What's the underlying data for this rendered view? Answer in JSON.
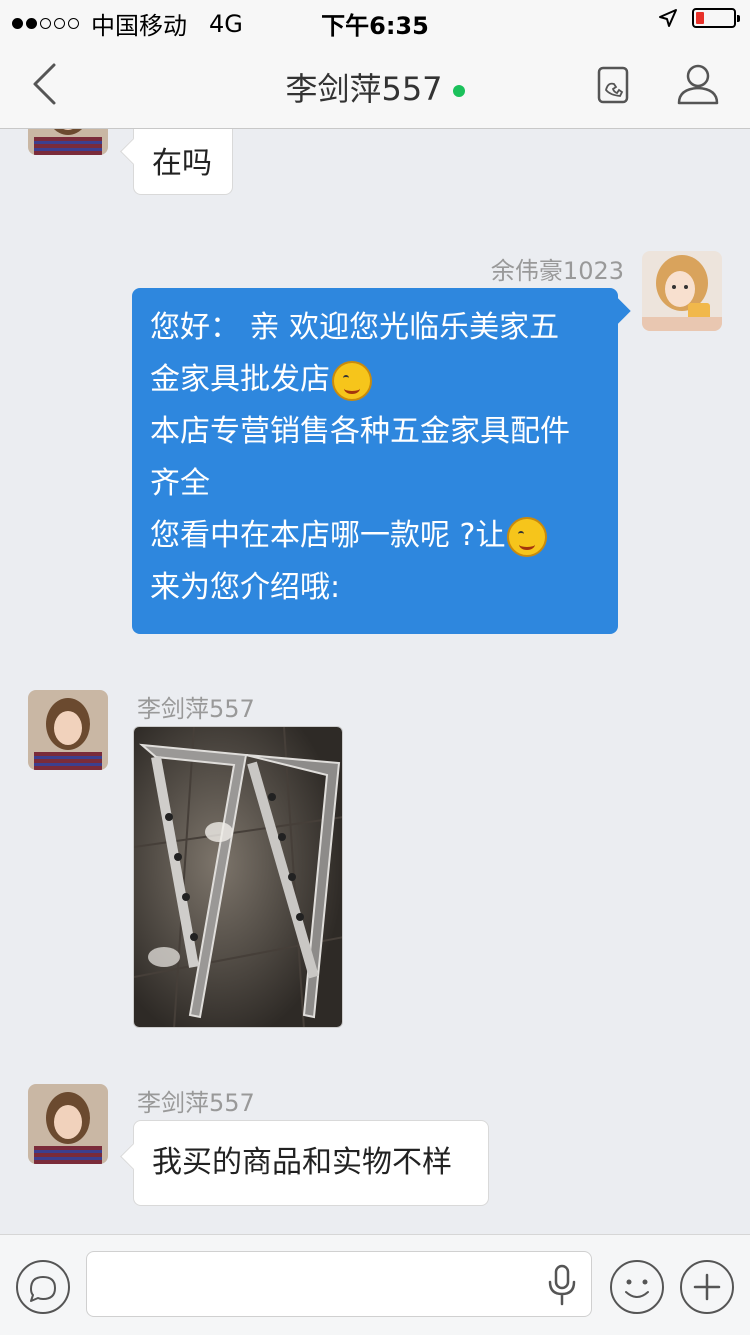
{
  "status_bar": {
    "carrier": "中国移动",
    "network": "4G",
    "time": "下午6:35"
  },
  "header": {
    "title": "李剑萍557"
  },
  "messages": [
    {
      "direction": "in",
      "text": "在吗"
    },
    {
      "direction": "out",
      "sender": "余伟豪1023",
      "lines": {
        "l1": "您好： 亲 欢迎您光临乐美家五",
        "l2": "金家具批发店",
        "l3": "本店专营销售各种五金家具配件",
        "l4": "齐全",
        "l5": "您看中在本店哪一款呢 ?让",
        "l6": "来为您介绍哦:"
      }
    },
    {
      "direction": "in",
      "sender": "李剑萍557",
      "type": "image"
    },
    {
      "direction": "in",
      "sender": "李剑萍557",
      "text": "我买的商品和实物不样"
    }
  ],
  "colors": {
    "accent": "#2e87de",
    "online": "#1bc15b",
    "battery": "#e8312a"
  },
  "icons": [
    "back-chevron-icon",
    "phone-doc-icon",
    "profile-icon",
    "chat-bubble-icon",
    "microphone-icon",
    "emoji-icon",
    "plus-icon"
  ]
}
